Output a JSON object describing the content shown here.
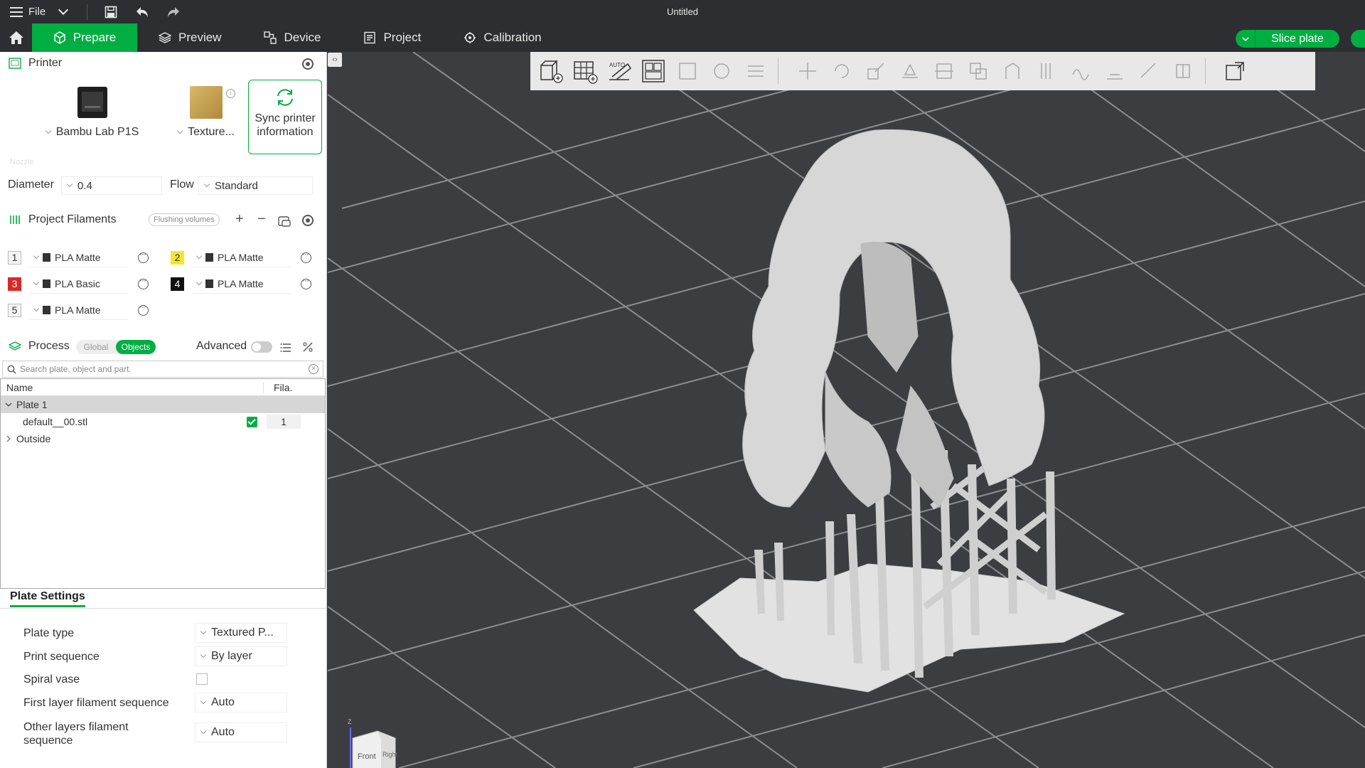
{
  "titlebar": {
    "file_label": "File",
    "title": "Untitled"
  },
  "nav": {
    "tabs": [
      {
        "label": "Prepare",
        "icon": "cube-icon"
      },
      {
        "label": "Preview",
        "icon": "layers-icon"
      },
      {
        "label": "Device",
        "icon": "device-icon"
      },
      {
        "label": "Project",
        "icon": "project-icon"
      },
      {
        "label": "Calibration",
        "icon": "calibration-icon"
      }
    ],
    "slice_label": "Slice plate"
  },
  "printer": {
    "heading": "Printer",
    "printer_name": "Bambu Lab P1S",
    "plate_name": "Texture...",
    "sync_label": "Sync printer information",
    "nozzle_label": "Nozzle",
    "diameter_label": "Diameter",
    "diameter_value": "0.4",
    "flow_label": "Flow",
    "flow_value": "Standard"
  },
  "filaments": {
    "heading": "Project Filaments",
    "flushing_label": "Flushing volumes",
    "items": [
      {
        "num": "1",
        "name": "PLA Matte",
        "color": "#f4f4f4",
        "text_color": "#333"
      },
      {
        "num": "2",
        "name": "PLA Matte",
        "color": "#f5e532",
        "text_color": "#333"
      },
      {
        "num": "3",
        "name": "PLA Basic",
        "color": "#d8282a",
        "text_color": "#fff"
      },
      {
        "num": "4",
        "name": "PLA Matte",
        "color": "#111111",
        "text_color": "#fff"
      },
      {
        "num": "5",
        "name": "PLA Matte",
        "color": "#f4f4f4",
        "text_color": "#333"
      }
    ]
  },
  "process": {
    "heading": "Process",
    "global_label": "Global",
    "objects_label": "Objects",
    "advanced_label": "Advanced",
    "search_placeholder": "Search plate, object and part.",
    "col_name": "Name",
    "col_fila": "Fila.",
    "plate_row": "Plate 1",
    "object_row": "default__00.stl",
    "object_fila": "1",
    "outside_row": "Outside"
  },
  "plate_settings": {
    "tab_label": "Plate Settings",
    "rows": [
      {
        "label": "Plate type",
        "value": "Textured P..."
      },
      {
        "label": "Print sequence",
        "value": "By layer"
      },
      {
        "label": "Spiral vase",
        "value": ""
      },
      {
        "label": "First layer filament sequence",
        "value": "Auto"
      },
      {
        "label": "Other layers filament sequence",
        "value": "Auto"
      }
    ]
  },
  "viewcube": {
    "front_label": "Front",
    "right_label": "Right",
    "axis_label": "Z"
  },
  "colors": {
    "accent": "#00ae42",
    "bed": "#3c3d40",
    "grid": "#9a9b9e",
    "model": "#d9d9d9"
  }
}
